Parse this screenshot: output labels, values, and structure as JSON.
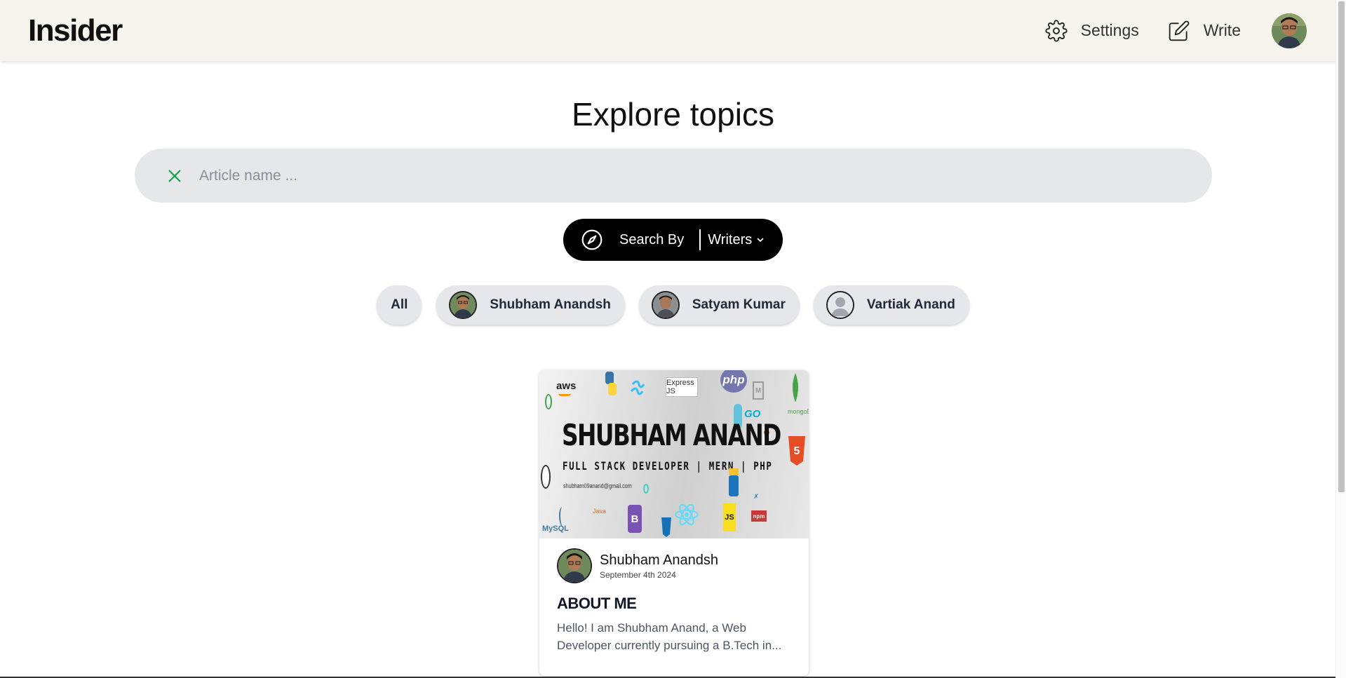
{
  "header": {
    "logo": "Insider",
    "settings_label": "Settings",
    "write_label": "Write"
  },
  "main": {
    "title": "Explore topics",
    "search": {
      "placeholder": "Article name ...",
      "value": ""
    },
    "search_by": {
      "label": "Search By",
      "selected": "Writers"
    },
    "filters": [
      {
        "label": "All"
      },
      {
        "label": "Shubham Anandsh"
      },
      {
        "label": "Satyam Kumar"
      },
      {
        "label": "Vartiak Anand"
      }
    ]
  },
  "card": {
    "banner": {
      "name": "SHUBHAM ANAND",
      "subtitle": "FULL STACK DEVELOPER | MERN | PHP",
      "email": "shubham09anand@gmail.com",
      "logos": [
        "aws",
        "php",
        "Express JS",
        "GO",
        "mongoDB",
        "JS",
        "B",
        "MySQL",
        "Java"
      ]
    },
    "author": "Shubham Anandsh",
    "date": "September 4th 2024",
    "title": "ABOUT ME",
    "excerpt": "Hello! I am Shubham Anand, a Web Developer currently pursuing a B.Tech in..."
  },
  "icons": {
    "settings": "gear-icon",
    "write": "edit-icon",
    "clear": "close-icon",
    "search_by": "compass-icon",
    "dropdown": "chevron-down-icon"
  },
  "colors": {
    "header_bg": "#f7f4ee",
    "search_bg": "#e5e7eb",
    "clear_icon": "#16a34a",
    "search_by_bg": "#000000"
  }
}
